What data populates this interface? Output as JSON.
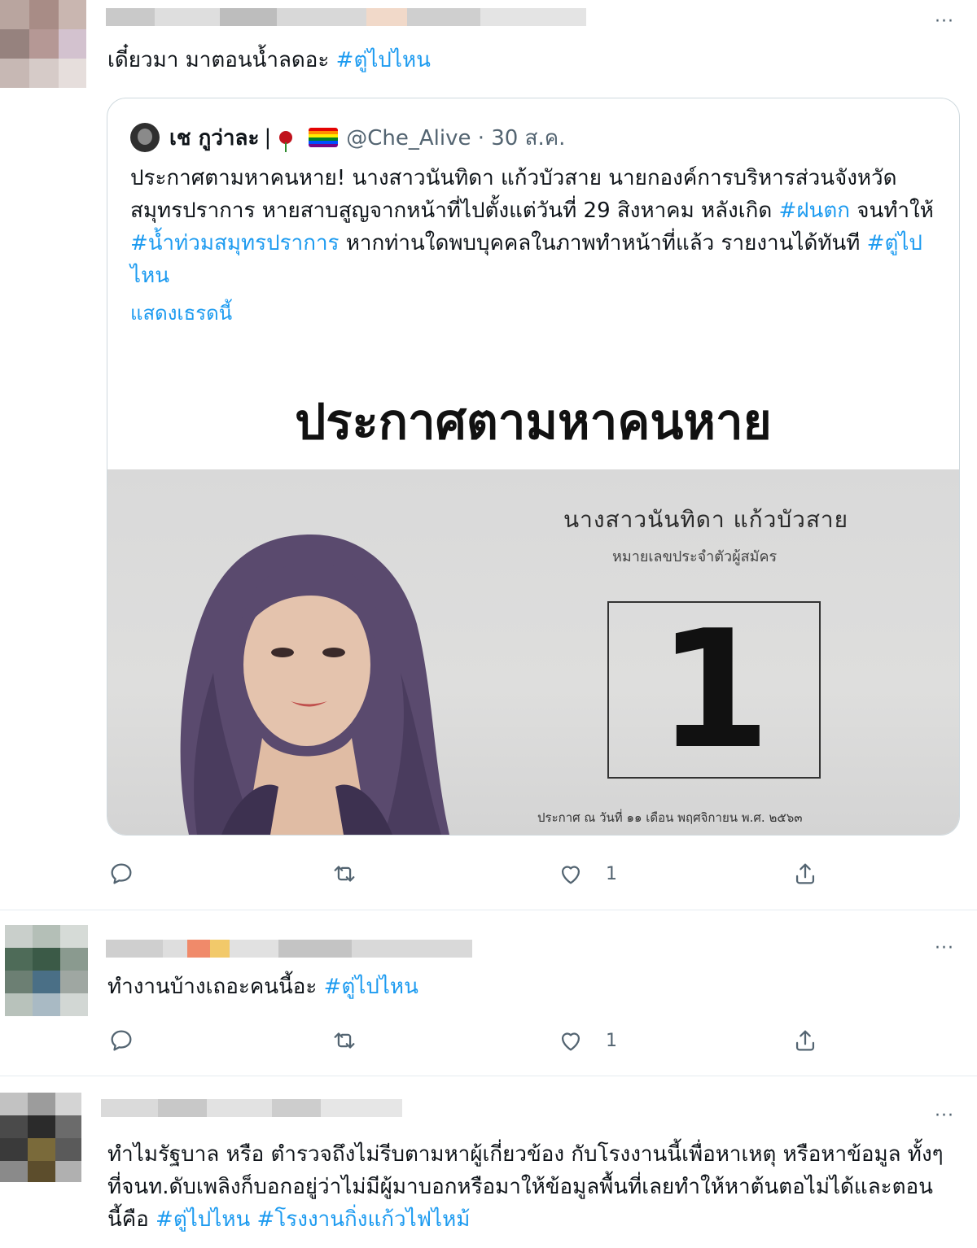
{
  "tweet1": {
    "text_plain": "เดี๋ยวมา มาตอนน้ำลดอะ ",
    "text_tag": "#ตู่ไปไหน",
    "more": "···",
    "quote": {
      "name": "เช กูว่าละ",
      "name_sep": "|",
      "handle": "@Che_Alive · 30 ส.ค.",
      "text_1": "ประกาศตามหาคนหาย! นางสาวนันทิดา แก้วบัวสาย นายกองค์การบริหารส่วนจังหวัดสมุทรปราการ หายสาบสูญจากหน้าที่ไปตั้งแต่วันที่ 29 สิงหาคม หลังเกิด",
      "text_tag_a": "#ฝนตก",
      "text_2": " จนทำให้ ",
      "text_tag_b": "#น้ำท่วมสมุทรปราการ",
      "text_3": " หากท่านใดพบบุคคลในภาพทำหน้าที่แล้ว รายงานได้ทันที ",
      "text_tag_c": "#ตู่ไปไหน",
      "show_thread": "แสดงเธรดนี้",
      "poster": {
        "title": "ประกาศตามหาคนหาย",
        "name": "นางสาวนันทิดา  แก้วบัวสาย",
        "subtitle": "หมายเลขประจำตัวผู้สมัคร",
        "number": "1",
        "footer": "ประกาศ ณ วันที่ ๑๑ เดือน พฤศจิกายน พ.ศ. ๒๕๖๓"
      }
    },
    "actions": {
      "reply": "",
      "retweet": "",
      "like_count": "1",
      "share": ""
    }
  },
  "tweet2": {
    "text_plain": "ทำงานบ้างเถอะคนนี้อะ ",
    "text_tag": "#ตู่ไปไหน",
    "more": "···",
    "actions": {
      "like_count": "1"
    }
  },
  "tweet3": {
    "text_plain": "ทำไมรัฐบาล หรือ ตำรวจถึงไม่รีบตามหาผู้เกี่ยวข้อง กับโรงงานนี้เพื่อหาเหตุ หรือหาข้อมูล ทั้งๆที่จนท.ดับเพลิงก็บอกอยู่ว่าไม่มีผู้มาบอกหรือมาให้ข้อมูลพื้นที่เลยทำให้หาต้นตอไม่ได้และตอนนี้คือ ",
    "text_tag_a": "#ตู่ไปไหน",
    "text_tag_b": " #โรงงานกิ่งแก้วไฟไหม้",
    "more": "···"
  },
  "colors": {
    "link": "#1d9bf0",
    "border": "#cfd9de",
    "muted": "#536471"
  }
}
